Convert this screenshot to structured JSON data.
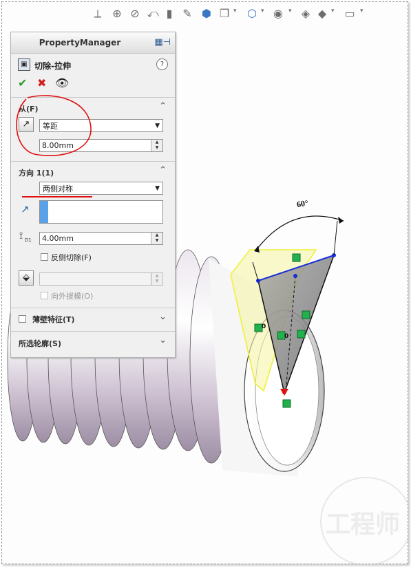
{
  "toolbar": {
    "icons": [
      "view-orientation-icon",
      "zoom-to-fit-icon",
      "zoom-area-icon",
      "previous-view-icon",
      "section-view-icon",
      "dynamic-annotation-icon",
      "view-cube-icon",
      "display-style-icon",
      "hide-show-icon",
      "edit-appearance-icon",
      "apply-scene-icon",
      "view-settings-icon"
    ]
  },
  "property_manager": {
    "header_title": "PropertyManager",
    "feature_title": "切除-拉伸",
    "help_glyph": "?",
    "from_section": {
      "title": "从(F)",
      "type_value": "等距",
      "offset_value": "8.00mm"
    },
    "direction1": {
      "title": "方向 1(1)",
      "end_condition": "两侧对称",
      "depth_value": "4.00mm",
      "depth_label": "D1",
      "flip_side_label": "反侧切除(F)",
      "draft_label": "向外拔模(O)"
    },
    "thin_feature": {
      "title": "薄壁特征(T)"
    },
    "selected_contours": {
      "title": "所选轮廓(S)"
    }
  },
  "dimension_angle": "60°",
  "relations": {
    "coincident_label": "0",
    "coincident_label_2": "0"
  },
  "colors": {
    "blue_line": "#1a2bdc",
    "yellow_highlight": "#f0f03a",
    "green_relation": "#22b14c",
    "red_annotation": "#e01010"
  },
  "watermark_text": "工程师"
}
